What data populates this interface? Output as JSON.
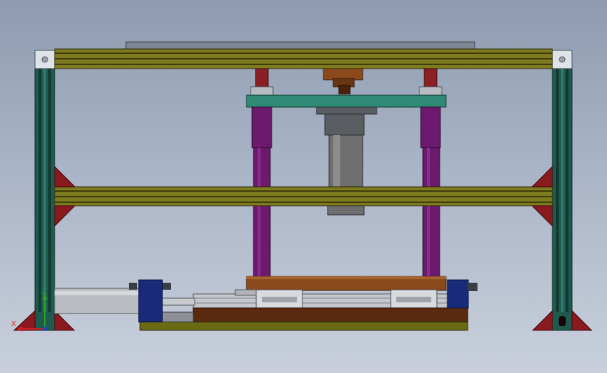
{
  "viewport": {
    "background_top": "#8e9bb0",
    "background_bottom": "#c9d0dc"
  },
  "colors": {
    "frame_post": "#1e5a4e",
    "frame_post_dark": "#123a33",
    "beam_olive": "#7d7a1f",
    "beam_dark": "#3f3d0c",
    "gusset": "#8a1a1f",
    "column_purple": "#6b1a6e",
    "stub_red": "#8a1f24",
    "plate_teal": "#2e8a74",
    "top_cover": "#7f8694",
    "motor_grey": "#6f6f6f",
    "press_wood": "#8b4a1c",
    "base_brown": "#5a2a10",
    "base_olive": "#6b6a14",
    "cylinder_silver": "#b9bcc0",
    "cylinder_cap_blue": "#1a2a7a"
  },
  "triad": {
    "x_label": "X",
    "y_label": "Y",
    "x_color": "#d42020",
    "y_color": "#2aa02a",
    "z_color": "#2040d0"
  },
  "parts": [
    "left-post",
    "right-post",
    "top-beam",
    "middle-beam",
    "top-cover-plate",
    "upper-gussets",
    "lower-gussets",
    "guide-columns",
    "column-stubs",
    "moving-plate",
    "spindle-motor",
    "press-platen",
    "slide-rails",
    "base-plate",
    "air-cylinder",
    "cylinder-end-caps"
  ]
}
